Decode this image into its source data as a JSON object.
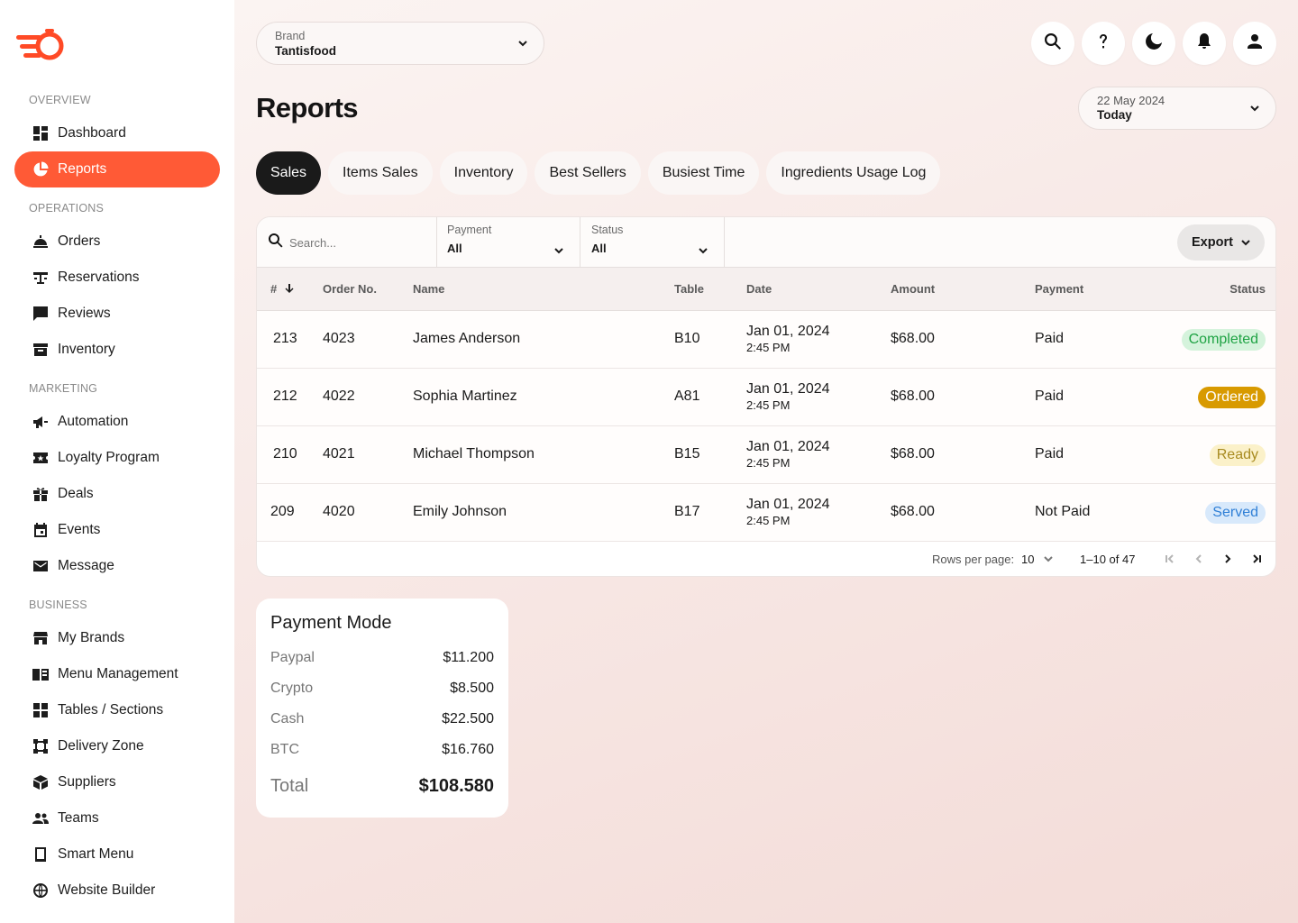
{
  "sidebar": {
    "sections": {
      "overview": "OVERVIEW",
      "operations": "OPERATIONS",
      "marketing": "MARKETING",
      "business": "BUSINESS"
    },
    "items": [
      {
        "label": "Dashboard",
        "icon": "dashboard-icon"
      },
      {
        "label": "Reports",
        "icon": "pie-chart-icon",
        "active": true
      },
      {
        "label": "Orders",
        "icon": "cloche-icon"
      },
      {
        "label": "Reservations",
        "icon": "table-icon"
      },
      {
        "label": "Reviews",
        "icon": "chat-icon"
      },
      {
        "label": "Inventory",
        "icon": "archive-icon"
      },
      {
        "label": "Automation",
        "icon": "megaphone-icon"
      },
      {
        "label": "Loyalty Program",
        "icon": "ticket-icon"
      },
      {
        "label": "Deals",
        "icon": "gift-icon"
      },
      {
        "label": "Events",
        "icon": "calendar-icon"
      },
      {
        "label": "Message",
        "icon": "mail-icon"
      },
      {
        "label": "My Brands",
        "icon": "storefront-icon"
      },
      {
        "label": "Menu Management",
        "icon": "menu-book-icon"
      },
      {
        "label": "Tables / Sections",
        "icon": "grid-icon"
      },
      {
        "label": "Delivery Zone",
        "icon": "polygon-icon"
      },
      {
        "label": "Suppliers",
        "icon": "box-icon"
      },
      {
        "label": "Teams",
        "icon": "people-icon"
      },
      {
        "label": "Smart Menu",
        "icon": "tablet-icon"
      },
      {
        "label": "Website Builder",
        "icon": "globe-icon"
      }
    ]
  },
  "header": {
    "brand_caption": "Brand",
    "brand_value": "Tantisfood",
    "title": "Reports",
    "date_caption": "22 May 2024",
    "date_value": "Today",
    "icons": [
      "search-icon",
      "help-icon",
      "dark-mode-icon",
      "bell-icon",
      "user-icon"
    ]
  },
  "tabs": [
    {
      "label": "Sales",
      "active": true
    },
    {
      "label": "Items Sales"
    },
    {
      "label": "Inventory"
    },
    {
      "label": "Best Sellers"
    },
    {
      "label": "Busiest Time"
    },
    {
      "label": "Ingredients Usage Log"
    }
  ],
  "filters": {
    "search_placeholder": "Search...",
    "payment_caption": "Payment",
    "payment_value": "All",
    "status_caption": "Status",
    "status_value": "All",
    "export_label": "Export"
  },
  "table": {
    "columns": [
      "#",
      "Order No.",
      "Name",
      "Table",
      "Date",
      "Amount",
      "Payment",
      "Status"
    ],
    "rows": [
      {
        "id": "213",
        "order": "4023",
        "name": "James Anderson",
        "table": "B10",
        "date": "Jan 01, 2024",
        "time": "2:45 PM",
        "amount": "$68.00",
        "payment": "Paid",
        "status": "Completed"
      },
      {
        "id": "212",
        "order": "4022",
        "name": "Sophia Martinez",
        "table": "A81",
        "date": "Jan 01, 2024",
        "time": "2:45 PM",
        "amount": "$68.00",
        "payment": "Paid",
        "status": "Ordered"
      },
      {
        "id": "210",
        "order": "4021",
        "name": "Michael Thompson",
        "table": "B15",
        "date": "Jan 01, 2024",
        "time": "2:45 PM",
        "amount": "$68.00",
        "payment": "Paid",
        "status": "Ready"
      },
      {
        "id": "209",
        "order": "4020",
        "name": "Emily Johnson",
        "table": "B17",
        "date": "Jan 01, 2024",
        "time": "2:45 PM",
        "amount": "$68.00",
        "payment": "Not Paid",
        "status": "Served"
      }
    ],
    "status_colors": {
      "Completed": "#1fa344",
      "Ordered": "#d89a00",
      "Ready": "#a88b20",
      "Served": "#2f7fd6"
    }
  },
  "pager": {
    "rows_per_page_label": "Rows per page:",
    "rows_per_page_value": "10",
    "range": "1–10 of 47"
  },
  "payment_mode": {
    "title": "Payment Mode",
    "items": [
      {
        "label": "Paypal",
        "value": "$11.200"
      },
      {
        "label": "Crypto",
        "value": "$8.500"
      },
      {
        "label": "Cash",
        "value": "$22.500"
      },
      {
        "label": "BTC",
        "value": "$16.760"
      }
    ],
    "total_label": "Total",
    "total_value": "$108.580"
  },
  "colors": {
    "accent": "#ff5a36",
    "dark": "#1a1a1a"
  }
}
